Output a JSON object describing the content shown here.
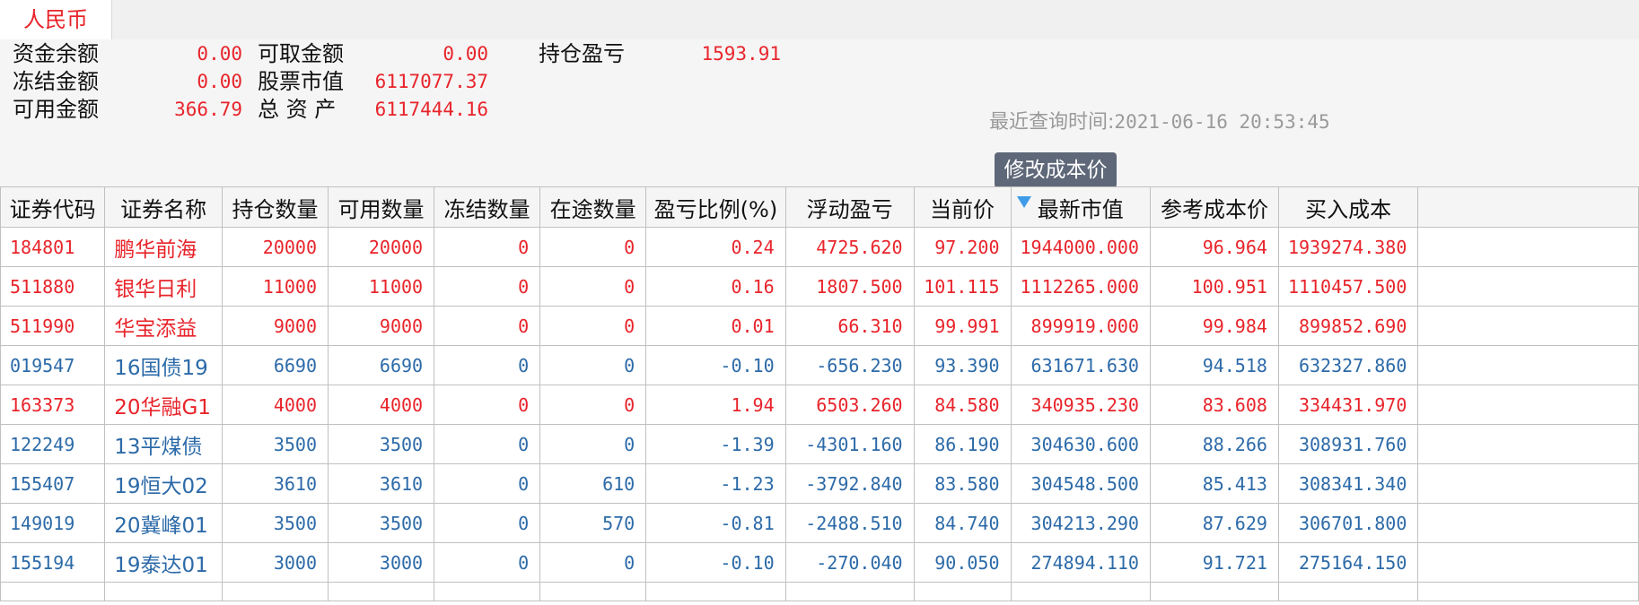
{
  "tab": {
    "label": "人民币"
  },
  "summary": {
    "cash_balance_label": "资金余额",
    "cash_balance": "0.00",
    "frozen_label": "冻结金额",
    "frozen": "0.00",
    "available_label": "可用金额",
    "available": "366.79",
    "withdrawable_label": "可取金额",
    "withdrawable": "0.00",
    "market_value_label": "股票市值",
    "market_value": "6117077.37",
    "total_assets_label": "总 资 产",
    "total_assets": "6117444.16",
    "position_pnl_label": "持仓盈亏",
    "position_pnl": "1593.91",
    "query_time_label": "最近查询时间:",
    "query_time": "2021-06-16 20:53:45",
    "modify_cost_button": "修改成本价"
  },
  "colors": {
    "up": "#e8242b",
    "down": "#2c6aa8",
    "button_bg": "#5f6879",
    "sort_arrow": "#3e9be8"
  },
  "table": {
    "sorted_column": "最新市值",
    "sort_direction": "descending",
    "sort_icon": "sort-desc-icon",
    "columns": [
      "证券代码",
      "证券名称",
      "持仓数量",
      "可用数量",
      "冻结数量",
      "在途数量",
      "盈亏比例(%)",
      "浮动盈亏",
      "当前价",
      "最新市值",
      "参考成本价",
      "买入成本"
    ],
    "rows": [
      {
        "trend": "up",
        "cells": [
          "184801",
          "鹏华前海",
          "20000",
          "20000",
          "0",
          "0",
          "0.24",
          "4725.620",
          "97.200",
          "1944000.000",
          "96.964",
          "1939274.380"
        ]
      },
      {
        "trend": "up",
        "cells": [
          "511880",
          "银华日利",
          "11000",
          "11000",
          "0",
          "0",
          "0.16",
          "1807.500",
          "101.115",
          "1112265.000",
          "100.951",
          "1110457.500"
        ]
      },
      {
        "trend": "up",
        "cells": [
          "511990",
          "华宝添益",
          "9000",
          "9000",
          "0",
          "0",
          "0.01",
          "66.310",
          "99.991",
          "899919.000",
          "99.984",
          "899852.690"
        ]
      },
      {
        "trend": "down",
        "cells": [
          "019547",
          "16国债19",
          "6690",
          "6690",
          "0",
          "0",
          "-0.10",
          "-656.230",
          "93.390",
          "631671.630",
          "94.518",
          "632327.860"
        ]
      },
      {
        "trend": "up",
        "cells": [
          "163373",
          "20华融G1",
          "4000",
          "4000",
          "0",
          "0",
          "1.94",
          "6503.260",
          "84.580",
          "340935.230",
          "83.608",
          "334431.970"
        ]
      },
      {
        "trend": "down",
        "cells": [
          "122249",
          "13平煤债",
          "3500",
          "3500",
          "0",
          "0",
          "-1.39",
          "-4301.160",
          "86.190",
          "304630.600",
          "88.266",
          "308931.760"
        ]
      },
      {
        "trend": "down",
        "cells": [
          "155407",
          "19恒大02",
          "3610",
          "3610",
          "0",
          "610",
          "-1.23",
          "-3792.840",
          "83.580",
          "304548.500",
          "85.413",
          "308341.340"
        ]
      },
      {
        "trend": "down",
        "cells": [
          "149019",
          "20冀峰01",
          "3500",
          "3500",
          "0",
          "570",
          "-0.81",
          "-2488.510",
          "84.740",
          "304213.290",
          "87.629",
          "306701.800"
        ]
      },
      {
        "trend": "down",
        "cells": [
          "155194",
          "19泰达01",
          "3000",
          "3000",
          "0",
          "0",
          "-0.10",
          "-270.040",
          "90.050",
          "274894.110",
          "91.721",
          "275164.150"
        ]
      }
    ]
  }
}
